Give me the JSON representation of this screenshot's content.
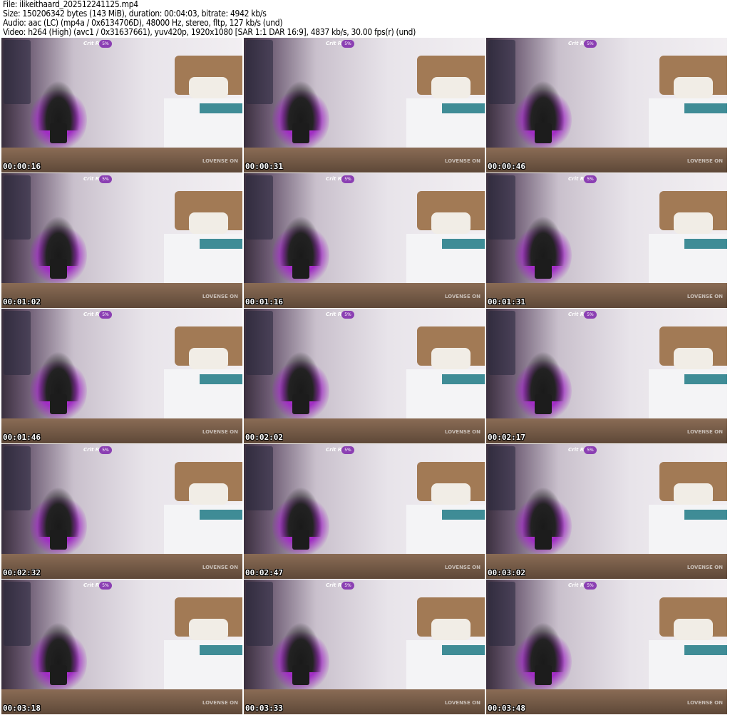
{
  "header": {
    "file": "File: ilikeithaard_202512241125.mp4",
    "size": "Size: 150206342 bytes (143 MiB), duration: 00:04:03, bitrate: 4942 kb/s",
    "audio": "Audio: aac (LC) (mp4a / 0x6134706D), 48000 Hz, stereo, fltp, 127 kb/s (und)",
    "video": "Video: h264 (High) (avc1 / 0x31637661), yuv420p, 1920x1080 [SAR 1:1 DAR 16:9], 4837 kb/s, 30.00 fps(r) (und)"
  },
  "overlay": {
    "crit_label": "Crit Rate",
    "crit_value": "5%",
    "brand": "LOVENSE ON"
  },
  "thumbnails": [
    {
      "timestamp": "00:00:16"
    },
    {
      "timestamp": "00:00:31"
    },
    {
      "timestamp": "00:00:46"
    },
    {
      "timestamp": "00:01:02"
    },
    {
      "timestamp": "00:01:16"
    },
    {
      "timestamp": "00:01:31"
    },
    {
      "timestamp": "00:01:46"
    },
    {
      "timestamp": "00:02:02"
    },
    {
      "timestamp": "00:02:17"
    },
    {
      "timestamp": "00:02:32"
    },
    {
      "timestamp": "00:02:47"
    },
    {
      "timestamp": "00:03:02"
    },
    {
      "timestamp": "00:03:18"
    },
    {
      "timestamp": "00:03:33"
    },
    {
      "timestamp": "00:03:48"
    }
  ]
}
